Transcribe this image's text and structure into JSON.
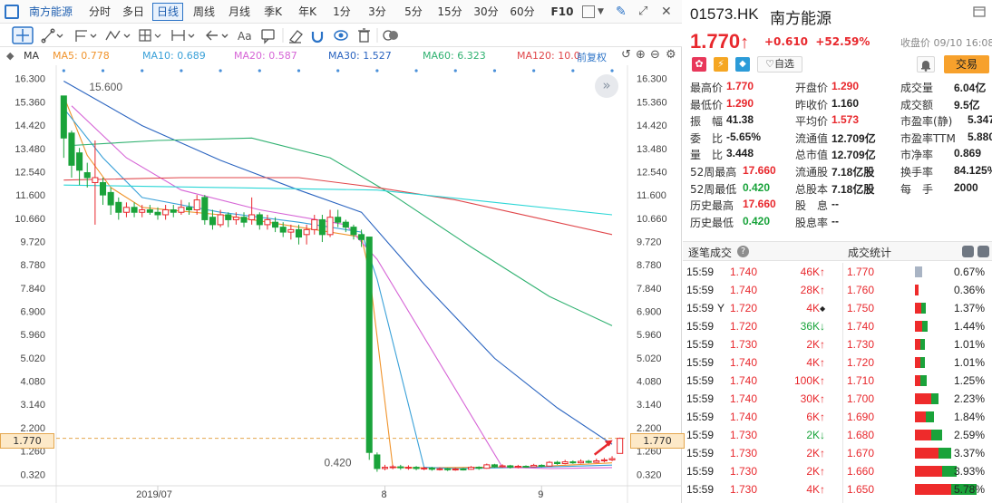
{
  "toolbar": {
    "stock_name": "南方能源",
    "periods": [
      "分时",
      "多日",
      "日线",
      "周线",
      "月线",
      "季K",
      "年K",
      "1分",
      "3分",
      "5分",
      "15分",
      "30分",
      "60分"
    ],
    "active_period": "日线",
    "f10_label": "F10"
  },
  "ma_bar": {
    "ma_label": "MA",
    "items": [
      {
        "label": "MA5: 0.778",
        "color": "#f0932b"
      },
      {
        "label": "MA10: 0.689",
        "color": "#3aa1d8"
      },
      {
        "label": "MA20: 0.587",
        "color": "#d665d6"
      },
      {
        "label": "MA30: 1.527",
        "color": "#2a64c0"
      },
      {
        "label": "MA60: 6.323",
        "color": "#2fb170"
      },
      {
        "label": "MA120: 10.0",
        "color": "#e0464a"
      }
    ],
    "adjust_label": "前复权"
  },
  "chart_data": {
    "type": "candlestick",
    "ylim": [
      0.0,
      16.4
    ],
    "y_ticks": [
      16.3,
      15.36,
      14.42,
      13.48,
      12.54,
      11.6,
      10.66,
      9.72,
      8.78,
      7.84,
      6.9,
      5.96,
      5.02,
      4.08,
      3.14,
      2.2,
      1.26,
      0.32
    ],
    "x_labels": [
      "2019/07",
      "8",
      "9"
    ],
    "current_price_tag": "1.770",
    "annotations": [
      {
        "label": "15.600",
        "candle_index": 0,
        "value": 15.6
      },
      {
        "label": "0.420",
        "candle_index": 30,
        "value": 0.42
      }
    ],
    "candles": [
      {
        "o": 15.6,
        "c": 13.9,
        "h": 15.6,
        "l": 13.1
      },
      {
        "o": 14.1,
        "c": 12.8,
        "h": 14.2,
        "l": 12.3
      },
      {
        "o": 13.3,
        "c": 12.6,
        "h": 13.5,
        "l": 12.0
      },
      {
        "o": 12.5,
        "c": 12.3,
        "h": 12.9,
        "l": 11.9
      },
      {
        "o": 12.1,
        "c": 12.3,
        "h": 13.8,
        "l": 10.4
      },
      {
        "o": 12.1,
        "c": 11.6,
        "h": 12.3,
        "l": 11.2
      },
      {
        "o": 11.7,
        "c": 11.2,
        "h": 11.9,
        "l": 10.8
      },
      {
        "o": 11.3,
        "c": 10.9,
        "h": 11.5,
        "l": 10.6
      },
      {
        "o": 10.9,
        "c": 11.1,
        "h": 11.3,
        "l": 10.7
      },
      {
        "o": 11.1,
        "c": 10.9,
        "h": 11.3,
        "l": 10.7
      },
      {
        "o": 10.9,
        "c": 11.0,
        "h": 11.2,
        "l": 10.7
      },
      {
        "o": 11.0,
        "c": 10.9,
        "h": 11.2,
        "l": 10.8
      },
      {
        "o": 10.9,
        "c": 10.8,
        "h": 11.1,
        "l": 10.6
      },
      {
        "o": 10.8,
        "c": 11.0,
        "h": 11.2,
        "l": 10.6
      },
      {
        "o": 11.0,
        "c": 10.9,
        "h": 11.2,
        "l": 10.7
      },
      {
        "o": 10.9,
        "c": 11.1,
        "h": 11.4,
        "l": 10.8
      },
      {
        "o": 11.1,
        "c": 11.0,
        "h": 11.3,
        "l": 10.8
      },
      {
        "o": 11.0,
        "c": 11.4,
        "h": 11.6,
        "l": 10.8
      },
      {
        "o": 11.5,
        "c": 10.6,
        "h": 11.6,
        "l": 10.4
      },
      {
        "o": 10.7,
        "c": 10.4,
        "h": 11.0,
        "l": 10.2
      },
      {
        "o": 10.4,
        "c": 10.8,
        "h": 11.0,
        "l": 10.3
      },
      {
        "o": 10.8,
        "c": 10.6,
        "h": 10.9,
        "l": 10.3
      },
      {
        "o": 10.6,
        "c": 10.7,
        "h": 10.9,
        "l": 10.4
      },
      {
        "o": 10.7,
        "c": 10.5,
        "h": 10.9,
        "l": 10.3
      },
      {
        "o": 10.6,
        "c": 10.8,
        "h": 11.5,
        "l": 10.4
      },
      {
        "o": 10.8,
        "c": 10.4,
        "h": 10.9,
        "l": 10.2
      },
      {
        "o": 10.4,
        "c": 10.6,
        "h": 10.8,
        "l": 10.2
      },
      {
        "o": 10.5,
        "c": 10.3,
        "h": 10.7,
        "l": 10.1
      },
      {
        "o": 10.3,
        "c": 10.1,
        "h": 10.5,
        "l": 9.9
      },
      {
        "o": 10.1,
        "c": 10.2,
        "h": 10.4,
        "l": 9.8
      },
      {
        "o": 10.2,
        "c": 9.9,
        "h": 10.4,
        "l": 9.6
      },
      {
        "o": 10.0,
        "c": 10.2,
        "h": 10.4,
        "l": 9.6
      },
      {
        "o": 10.2,
        "c": 10.6,
        "h": 10.8,
        "l": 10.0
      },
      {
        "o": 10.6,
        "c": 10.0,
        "h": 10.8,
        "l": 9.7
      },
      {
        "o": 10.0,
        "c": 10.7,
        "h": 11.0,
        "l": 9.9
      },
      {
        "o": 10.7,
        "c": 10.5,
        "h": 11.0,
        "l": 10.3
      },
      {
        "o": 10.5,
        "c": 10.3,
        "h": 10.6,
        "l": 10.1
      },
      {
        "o": 10.3,
        "c": 10.0,
        "h": 10.4,
        "l": 9.8
      },
      {
        "o": 10.0,
        "c": 9.8,
        "h": 10.2,
        "l": 9.5
      },
      {
        "o": 9.9,
        "c": 1.2,
        "h": 9.9,
        "l": 0.9
      },
      {
        "o": 1.1,
        "c": 0.55,
        "h": 1.2,
        "l": 0.42
      },
      {
        "o": 0.55,
        "c": 0.6,
        "h": 0.7,
        "l": 0.48
      },
      {
        "o": 0.6,
        "c": 0.62,
        "h": 0.7,
        "l": 0.52
      },
      {
        "o": 0.62,
        "c": 0.58,
        "h": 0.7,
        "l": 0.5
      },
      {
        "o": 0.58,
        "c": 0.6,
        "h": 0.68,
        "l": 0.5
      },
      {
        "o": 0.6,
        "c": 0.55,
        "h": 0.65,
        "l": 0.48
      },
      {
        "o": 0.55,
        "c": 0.57,
        "h": 0.62,
        "l": 0.48
      },
      {
        "o": 0.57,
        "c": 0.52,
        "h": 0.62,
        "l": 0.46
      },
      {
        "o": 0.52,
        "c": 0.54,
        "h": 0.6,
        "l": 0.47
      },
      {
        "o": 0.54,
        "c": 0.5,
        "h": 0.58,
        "l": 0.45
      },
      {
        "o": 0.5,
        "c": 0.53,
        "h": 0.58,
        "l": 0.46
      },
      {
        "o": 0.53,
        "c": 0.52,
        "h": 0.58,
        "l": 0.47
      },
      {
        "o": 0.52,
        "c": 0.6,
        "h": 0.65,
        "l": 0.5
      },
      {
        "o": 0.6,
        "c": 0.56,
        "h": 0.64,
        "l": 0.5
      },
      {
        "o": 0.56,
        "c": 0.7,
        "h": 0.75,
        "l": 0.54
      },
      {
        "o": 0.7,
        "c": 0.62,
        "h": 0.74,
        "l": 0.58
      },
      {
        "o": 0.62,
        "c": 0.66,
        "h": 0.72,
        "l": 0.58
      },
      {
        "o": 0.66,
        "c": 0.6,
        "h": 0.7,
        "l": 0.55
      },
      {
        "o": 0.6,
        "c": 0.64,
        "h": 0.7,
        "l": 0.56
      },
      {
        "o": 0.64,
        "c": 0.62,
        "h": 0.68,
        "l": 0.58
      },
      {
        "o": 0.62,
        "c": 0.68,
        "h": 0.74,
        "l": 0.6
      },
      {
        "o": 0.68,
        "c": 0.65,
        "h": 0.72,
        "l": 0.6
      },
      {
        "o": 0.65,
        "c": 0.8,
        "h": 0.85,
        "l": 0.63
      },
      {
        "o": 0.8,
        "c": 0.75,
        "h": 0.86,
        "l": 0.7
      },
      {
        "o": 0.75,
        "c": 0.82,
        "h": 0.9,
        "l": 0.72
      },
      {
        "o": 0.82,
        "c": 0.78,
        "h": 0.88,
        "l": 0.74
      },
      {
        "o": 0.78,
        "c": 0.84,
        "h": 0.92,
        "l": 0.75
      },
      {
        "o": 0.84,
        "c": 0.8,
        "h": 0.9,
        "l": 0.76
      },
      {
        "o": 0.8,
        "c": 0.86,
        "h": 0.95,
        "l": 0.78
      },
      {
        "o": 0.86,
        "c": 0.9,
        "h": 0.98,
        "l": 0.8
      },
      {
        "o": 0.9,
        "c": 0.95,
        "h": 1.05,
        "l": 0.85
      },
      {
        "o": 1.16,
        "c": 1.77,
        "h": 1.8,
        "l": 1.16
      }
    ],
    "ma_series": [
      {
        "name": "MA5",
        "color": "#f0932b",
        "points": [
          [
            0,
            15.6
          ],
          [
            3,
            13.2
          ],
          [
            6,
            11.9
          ],
          [
            10,
            11.1
          ],
          [
            20,
            10.8
          ],
          [
            30,
            10.3
          ],
          [
            38,
            9.9
          ],
          [
            39,
            8.5
          ],
          [
            42,
            0.6
          ],
          [
            45,
            0.58
          ],
          [
            60,
            0.62
          ],
          [
            70,
            0.78
          ]
        ]
      },
      {
        "name": "MA10",
        "color": "#3aa1d8",
        "points": [
          [
            0,
            15.1
          ],
          [
            5,
            13.1
          ],
          [
            10,
            11.5
          ],
          [
            20,
            10.9
          ],
          [
            30,
            10.5
          ],
          [
            38,
            10.1
          ],
          [
            40,
            8.2
          ],
          [
            46,
            0.6
          ],
          [
            50,
            0.55
          ],
          [
            60,
            0.6
          ],
          [
            70,
            0.69
          ]
        ]
      },
      {
        "name": "MA20",
        "color": "#d665d6",
        "points": [
          [
            1,
            15.2
          ],
          [
            8,
            13.1
          ],
          [
            15,
            11.8
          ],
          [
            25,
            11.0
          ],
          [
            36,
            10.4
          ],
          [
            40,
            9.0
          ],
          [
            56,
            0.6
          ],
          [
            62,
            0.55
          ],
          [
            70,
            0.59
          ]
        ]
      },
      {
        "name": "MA30",
        "color": "#2a64c0",
        "points": [
          [
            0,
            16.2
          ],
          [
            10,
            14.4
          ],
          [
            20,
            13.0
          ],
          [
            30,
            11.8
          ],
          [
            38,
            10.9
          ],
          [
            46,
            8.0
          ],
          [
            55,
            5.0
          ],
          [
            63,
            3.0
          ],
          [
            70,
            1.53
          ]
        ]
      },
      {
        "name": "MA60",
        "color": "#2fb170",
        "points": [
          [
            1,
            13.6
          ],
          [
            12,
            13.8
          ],
          [
            24,
            13.9
          ],
          [
            34,
            13.1
          ],
          [
            42,
            11.6
          ],
          [
            52,
            9.5
          ],
          [
            62,
            7.5
          ],
          [
            70,
            6.32
          ]
        ]
      },
      {
        "name": "MA120",
        "color": "#e0464a",
        "points": [
          [
            0,
            12.2
          ],
          [
            15,
            12.3
          ],
          [
            30,
            12.3
          ],
          [
            40,
            11.9
          ],
          [
            50,
            11.4
          ],
          [
            60,
            10.7
          ],
          [
            70,
            10.0
          ]
        ]
      },
      {
        "name": "MA250",
        "color": "#2bd6d6",
        "points": [
          [
            0,
            12.0
          ],
          [
            20,
            11.9
          ],
          [
            40,
            11.8
          ],
          [
            55,
            11.3
          ],
          [
            70,
            10.8
          ]
        ]
      }
    ]
  },
  "quote": {
    "code": "01573.HK",
    "name": "南方能源",
    "price": "1.770",
    "arrow": "↑",
    "change": "+0.610",
    "change_pct": "+52.59%",
    "close_time": "收盘价 09/10 16:08",
    "watch_label": "自选",
    "trade_label": "交易"
  },
  "stats": [
    [
      {
        "k": "最高价",
        "v": "1.770",
        "c": "red"
      },
      {
        "k": "开盘价",
        "v": "1.290",
        "c": "red"
      },
      {
        "k": "成交量",
        "v": "6.04亿",
        "c": "blk"
      }
    ],
    [
      {
        "k": "最低价",
        "v": "1.290",
        "c": "red"
      },
      {
        "k": "昨收价",
        "v": "1.160",
        "c": "blk"
      },
      {
        "k": "成交额",
        "v": "9.5亿",
        "c": "blk"
      }
    ],
    [
      {
        "k": "振　幅",
        "v": "41.38",
        "c": "blk"
      },
      {
        "k": "平均价",
        "v": "1.573",
        "c": "red"
      },
      {
        "k": "市盈率(静)",
        "v": "5.347",
        "c": "blk"
      }
    ],
    [
      {
        "k": "委　比",
        "v": "-5.65%",
        "c": "blk"
      },
      {
        "k": "流通值",
        "v": "12.709亿",
        "c": "blk"
      },
      {
        "k": "市盈率TTM",
        "v": "5.880",
        "c": "blk"
      }
    ],
    [
      {
        "k": "量　比",
        "v": "3.448",
        "c": "blk"
      },
      {
        "k": "总市值",
        "v": "12.709亿",
        "c": "blk"
      },
      {
        "k": "市净率",
        "v": "0.869",
        "c": "blk"
      }
    ],
    [
      {
        "k": "52周最高",
        "v": "17.660",
        "c": "red"
      },
      {
        "k": "流通股",
        "v": "7.18亿股",
        "c": "blk"
      },
      {
        "k": "换手率",
        "v": "84.125%",
        "c": "blk"
      }
    ],
    [
      {
        "k": "52周最低",
        "v": "0.420",
        "c": "green"
      },
      {
        "k": "总股本",
        "v": "7.18亿股",
        "c": "blk"
      },
      {
        "k": "每　手",
        "v": "2000",
        "c": "blk"
      }
    ],
    [
      {
        "k": "历史最高",
        "v": "17.660",
        "c": "red"
      },
      {
        "k": "股　息",
        "v": "--",
        "c": "blk"
      }
    ],
    [
      {
        "k": "历史最低",
        "v": "0.420",
        "c": "green"
      },
      {
        "k": "股息率",
        "v": "--",
        "c": "blk"
      }
    ]
  ],
  "trade_header": {
    "left": "逐笔成交",
    "right": "成交统计"
  },
  "trades": [
    {
      "time": "15:59",
      "flag": "",
      "price": "1.740",
      "vol": "46K",
      "dir": "up",
      "sp": "1.770",
      "red": 0,
      "green": 0,
      "gray": 8,
      "pct": "0.67%"
    },
    {
      "time": "15:59",
      "flag": "",
      "price": "1.740",
      "vol": "28K",
      "dir": "up",
      "sp": "1.760",
      "red": 4,
      "green": 0,
      "gray": 0,
      "pct": "0.36%"
    },
    {
      "time": "15:59",
      "flag": "Y",
      "price": "1.720",
      "vol": "4K",
      "dir": "flat",
      "sp": "1.750",
      "red": 7,
      "green": 5,
      "gray": 0,
      "pct": "1.37%"
    },
    {
      "time": "15:59",
      "flag": "",
      "price": "1.720",
      "vol": "36K",
      "dir": "down",
      "sp": "1.740",
      "red": 8,
      "green": 6,
      "gray": 0,
      "pct": "1.44%"
    },
    {
      "time": "15:59",
      "flag": "",
      "price": "1.730",
      "vol": "2K",
      "dir": "up",
      "sp": "1.730",
      "red": 6,
      "green": 5,
      "gray": 0,
      "pct": "1.01%"
    },
    {
      "time": "15:59",
      "flag": "",
      "price": "1.740",
      "vol": "4K",
      "dir": "up",
      "sp": "1.720",
      "red": 6,
      "green": 5,
      "gray": 0,
      "pct": "1.01%"
    },
    {
      "time": "15:59",
      "flag": "",
      "price": "1.740",
      "vol": "100K",
      "dir": "up",
      "sp": "1.710",
      "red": 6,
      "green": 7,
      "gray": 0,
      "pct": "1.25%"
    },
    {
      "time": "15:59",
      "flag": "",
      "price": "1.740",
      "vol": "30K",
      "dir": "up",
      "sp": "1.700",
      "red": 18,
      "green": 8,
      "gray": 0,
      "pct": "2.23%"
    },
    {
      "time": "15:59",
      "flag": "",
      "price": "1.740",
      "vol": "6K",
      "dir": "up",
      "sp": "1.690",
      "red": 12,
      "green": 9,
      "gray": 0,
      "pct": "1.84%"
    },
    {
      "time": "15:59",
      "flag": "",
      "price": "1.730",
      "vol": "2K",
      "dir": "down",
      "sp": "1.680",
      "red": 18,
      "green": 12,
      "gray": 0,
      "pct": "2.59%"
    },
    {
      "time": "15:59",
      "flag": "",
      "price": "1.730",
      "vol": "2K",
      "dir": "up",
      "sp": "1.670",
      "red": 26,
      "green": 14,
      "gray": 0,
      "pct": "3.37%"
    },
    {
      "time": "15:59",
      "flag": "",
      "price": "1.730",
      "vol": "2K",
      "dir": "up",
      "sp": "1.660",
      "red": 30,
      "green": 16,
      "gray": 0,
      "pct": "3.93%"
    },
    {
      "time": "15:59",
      "flag": "",
      "price": "1.730",
      "vol": "4K",
      "dir": "up",
      "sp": "1.650",
      "red": 40,
      "green": 28,
      "gray": 0,
      "pct": "5.78%"
    }
  ]
}
